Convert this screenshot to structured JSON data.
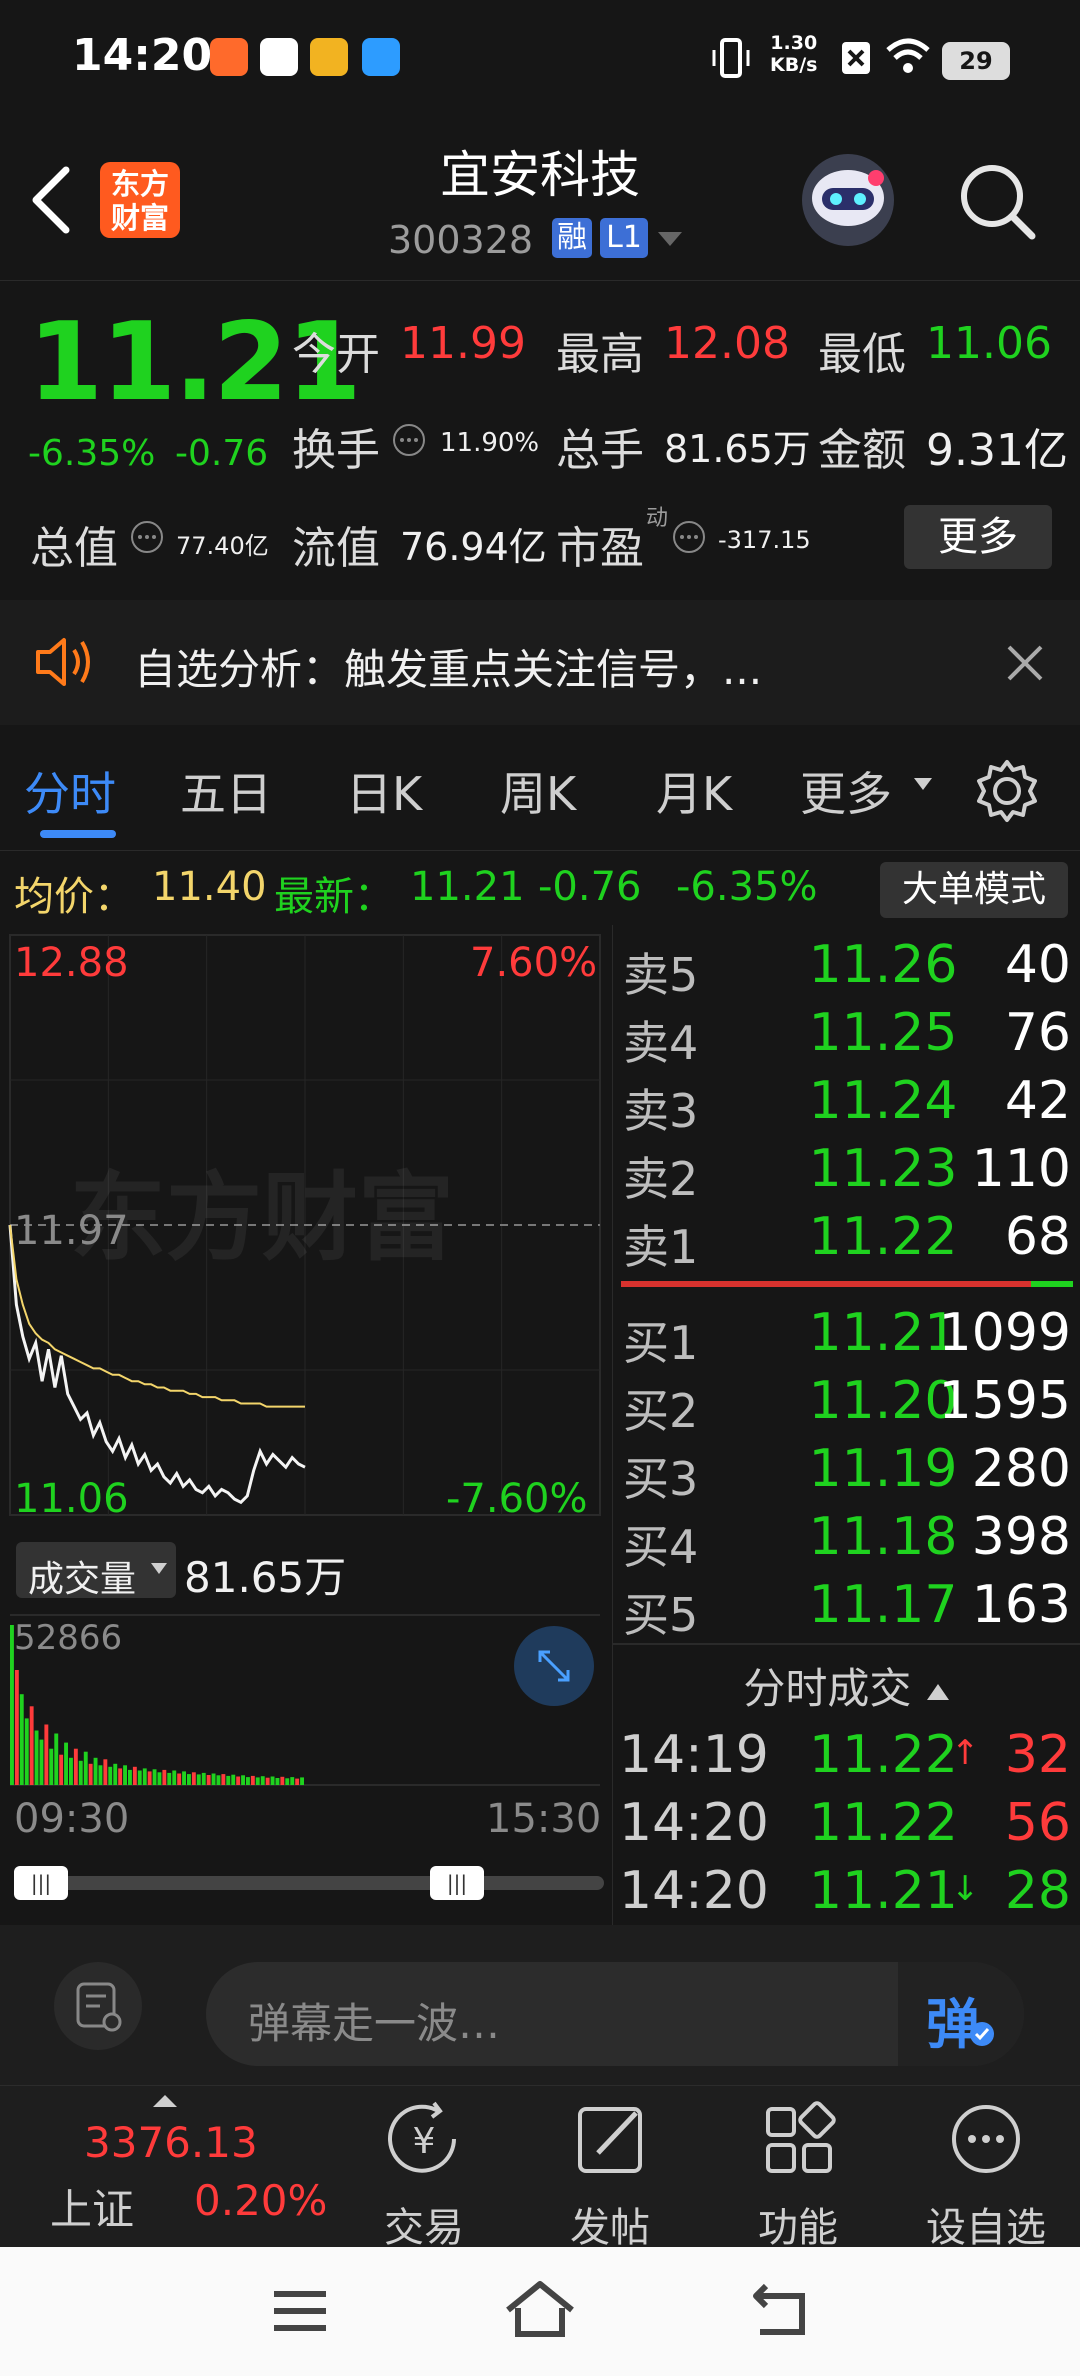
{
  "status_bar": {
    "time": "14:20",
    "net_speed": "1.30",
    "net_unit": "KB/s",
    "battery": "29"
  },
  "header": {
    "back": "‹",
    "logo_line1": "东方",
    "logo_line2": "财富",
    "stock_name": "宜安科技",
    "stock_code": "300328",
    "tag_margin": "融",
    "tag_level": "L1"
  },
  "quote": {
    "price": "11.21",
    "change_pct": "-6.35%",
    "change": "-0.76",
    "open_label": "今开",
    "open": "11.99",
    "high_label": "最高",
    "high": "12.08",
    "low_label": "最低",
    "low": "11.06",
    "turnover_label": "换手",
    "turnover": "11.90%",
    "volume_label": "总手",
    "volume": "81.65万",
    "amount_label": "金额",
    "amount": "9.31亿",
    "mktcap_label": "总值",
    "mktcap": "77.40亿",
    "float_label": "流值",
    "float_cap": "76.94亿",
    "pe_label": "市盈",
    "pe_sup": "动",
    "pe": "-317.15",
    "more_button": "更多"
  },
  "notice": {
    "text": "自选分析：触发重点关注信号，..."
  },
  "tabs": [
    {
      "label": "分时",
      "active": true
    },
    {
      "label": "五日"
    },
    {
      "label": "日K"
    },
    {
      "label": "周K"
    },
    {
      "label": "月K"
    },
    {
      "label": "更多"
    }
  ],
  "infoline": {
    "avg_label": "均价：",
    "avg": "11.40",
    "latest_label": "最新：",
    "latest": "11.21",
    "change": "-0.76",
    "change_pct": "-6.35%",
    "bigorder_button": "大单模式"
  },
  "chart": {
    "max_price": "12.88",
    "max_pct": "7.60%",
    "prev_close": "11.97",
    "min_price": "11.06",
    "min_pct": "-7.60%",
    "volume_select": "成交量",
    "volume_total": "81.65万",
    "volume_max": "52866",
    "time_start": "09:30",
    "time_end": "15:30",
    "watermark": "东方财富"
  },
  "chart_data": {
    "type": "line",
    "title": "",
    "xlabel": "",
    "ylabel": "",
    "ylim": [
      11.06,
      12.88
    ],
    "x_start": "09:30",
    "x_end": "15:30",
    "series": [
      {
        "values": [
          11.97,
          11.72,
          11.62,
          11.55,
          11.6,
          11.48,
          11.58,
          11.46,
          11.56,
          11.44,
          11.4,
          11.36,
          11.38,
          11.31,
          11.35,
          11.29,
          11.26,
          11.3,
          11.24,
          11.28,
          11.22,
          11.25,
          11.2,
          11.22,
          11.18,
          11.16,
          11.19,
          11.15,
          11.17,
          11.14,
          11.13,
          11.15,
          11.12,
          11.14,
          11.13,
          11.11,
          11.1,
          11.12,
          11.2,
          11.26,
          11.22,
          11.25,
          11.23,
          11.21,
          11.24,
          11.22,
          11.21
        ]
      },
      {
        "values": [
          11.97,
          11.8,
          11.72,
          11.66,
          11.63,
          11.61,
          11.6,
          11.58,
          11.57,
          11.56,
          11.55,
          11.54,
          11.53,
          11.52,
          11.52,
          11.51,
          11.5,
          11.5,
          11.49,
          11.48,
          11.48,
          11.47,
          11.47,
          11.46,
          11.46,
          11.45,
          11.45,
          11.45,
          11.44,
          11.44,
          11.43,
          11.43,
          11.43,
          11.42,
          11.42,
          11.42,
          11.41,
          11.41,
          11.41,
          11.41,
          11.4,
          11.4,
          11.4,
          11.4,
          11.4,
          11.4,
          11.4
        ]
      }
    ],
    "volume": [
      52866,
      38000,
      30000,
      22000,
      26000,
      18000,
      15000,
      20000,
      12000,
      17000,
      10000,
      14000,
      9000,
      12000,
      8000,
      11000,
      7000,
      9000,
      6500,
      8500,
      6000,
      7000,
      5500,
      6500,
      5000,
      6000,
      4800,
      5500,
      4500,
      5200,
      4200,
      5000,
      4000,
      4800,
      3800,
      4500,
      3600,
      4200,
      3500,
      4000,
      3300,
      3800,
      3200,
      3600,
      3000,
      3400,
      2800,
      3200,
      2600,
      3000,
      2500,
      2900,
      2400,
      2800,
      2300,
      2700,
      2200,
      2600,
      2100,
      2500
    ]
  },
  "orderbook": {
    "asks": [
      {
        "label": "卖5",
        "price": "11.26",
        "vol": "40"
      },
      {
        "label": "卖4",
        "price": "11.25",
        "vol": "76"
      },
      {
        "label": "卖3",
        "price": "11.24",
        "vol": "42"
      },
      {
        "label": "卖2",
        "price": "11.23",
        "vol": "110"
      },
      {
        "label": "卖1",
        "price": "11.22",
        "vol": "68"
      }
    ],
    "bids": [
      {
        "label": "买1",
        "price": "11.21",
        "vol": "1099"
      },
      {
        "label": "买2",
        "price": "11.20",
        "vol": "1595"
      },
      {
        "label": "买3",
        "price": "11.19",
        "vol": "280"
      },
      {
        "label": "买4",
        "price": "11.18",
        "vol": "398"
      },
      {
        "label": "买5",
        "price": "11.17",
        "vol": "163"
      }
    ],
    "ticks_title": "分时成交",
    "ticks": [
      {
        "time": "14:19",
        "price": "11.22",
        "arrow": "↑",
        "vol": "32"
      },
      {
        "time": "14:20",
        "price": "11.22",
        "arrow": "",
        "vol": "56"
      },
      {
        "time": "14:20",
        "price": "11.21",
        "arrow": "↓",
        "vol": "28"
      }
    ]
  },
  "comment": {
    "placeholder": "弹幕走一波…",
    "send_button": "弹"
  },
  "bottom_nav": {
    "index_value": "3376.13",
    "index_name": "上证",
    "index_pct": "0.20%",
    "items": [
      {
        "label": "交易",
        "icon": "yen-circle-icon"
      },
      {
        "label": "发帖",
        "icon": "edit-icon"
      },
      {
        "label": "功能",
        "icon": "grid-icon"
      },
      {
        "label": "设自选",
        "icon": "more-circle-icon"
      }
    ]
  },
  "colors": {
    "up": "#ff3b3b",
    "down": "#1fd21f",
    "accent": "#3d8af7",
    "avg_line": "#f3d56b",
    "brand": "#ff5a1f"
  }
}
